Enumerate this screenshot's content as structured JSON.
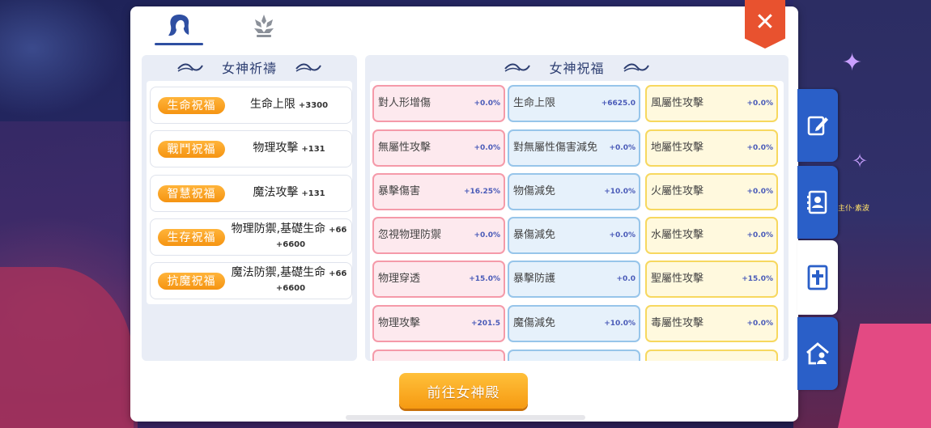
{
  "top_tabs": [
    {
      "name": "goddess-hair-icon",
      "active": true
    },
    {
      "name": "lotus-icon",
      "active": false
    }
  ],
  "left": {
    "title": "女神祈禱",
    "blessings": [
      {
        "badge": "生命祝福",
        "text": "生命上限",
        "value": "+3300"
      },
      {
        "badge": "戰鬥祝福",
        "text": "物理攻擊",
        "value": "+131"
      },
      {
        "badge": "智慧祝福",
        "text": "魔法攻擊",
        "value": "+131"
      },
      {
        "badge": "生存祝福",
        "text": "物理防禦,基礎生命",
        "value": "+66",
        "value2": "+6600"
      },
      {
        "badge": "抗魔祝福",
        "text": "魔法防禦,基礎生命",
        "value": "+66",
        "value2": "+6600"
      }
    ]
  },
  "right": {
    "title": "女神祝福",
    "stats": [
      [
        {
          "label": "對人形增傷",
          "value": "+0.0%"
        },
        {
          "label": "生命上限",
          "value": "+6625.0"
        },
        {
          "label": "風屬性攻擊",
          "value": "+0.0%"
        }
      ],
      [
        {
          "label": "無屬性攻擊",
          "value": "+0.0%"
        },
        {
          "label": "對無屬性傷害減免",
          "value": "+0.0%"
        },
        {
          "label": "地屬性攻擊",
          "value": "+0.0%"
        }
      ],
      [
        {
          "label": "暴擊傷害",
          "value": "+16.25%"
        },
        {
          "label": "物傷減免",
          "value": "+10.0%"
        },
        {
          "label": "火屬性攻擊",
          "value": "+0.0%"
        }
      ],
      [
        {
          "label": "忽視物理防禦",
          "value": "+0.0%"
        },
        {
          "label": "暴傷減免",
          "value": "+0.0%"
        },
        {
          "label": "水屬性攻擊",
          "value": "+0.0%"
        }
      ],
      [
        {
          "label": "物理穿透",
          "value": "+15.0%"
        },
        {
          "label": "暴擊防護",
          "value": "+0.0"
        },
        {
          "label": "聖屬性攻擊",
          "value": "+15.0%"
        }
      ],
      [
        {
          "label": "物理攻擊",
          "value": "+201.5"
        },
        {
          "label": "魔傷減免",
          "value": "+10.0%"
        },
        {
          "label": "毒屬性攻擊",
          "value": "+0.0%"
        }
      ]
    ]
  },
  "goto_button": "前往女神殿",
  "close_label": "✕",
  "side_tabs": [
    "note-edit-icon",
    "contacts-icon",
    "bible-icon",
    "home-person-icon"
  ],
  "bg_name": "主仆·素波",
  "colors": {
    "accent_blue": "#2a5fc8",
    "orange": "#f59412",
    "close_red": "#e8522f"
  }
}
